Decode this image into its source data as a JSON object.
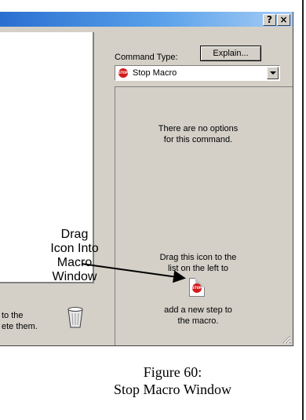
{
  "window": {
    "help_button": "?",
    "close_button": "×",
    "command_type_label": "Command Type:",
    "explain_button": "Explain...",
    "command_type_value": "Stop Macro",
    "no_options_line1": "There are no options",
    "no_options_line2": "for this command.",
    "drag_line1": "Drag this icon to the",
    "drag_line2": "list on the left to",
    "add_line1": "add a new step to",
    "add_line2": "the macro.",
    "trash_line1": "to the",
    "trash_line2": "ete them.",
    "stop_icon_text": "STOP"
  },
  "callout": {
    "line1": "Drag",
    "line2": "Icon Into",
    "line3": "Macro",
    "line4": "Window"
  },
  "caption": {
    "line1": "Figure 60:",
    "line2": "Stop Macro Window"
  },
  "colors": {
    "titlebar_start": "#2a6fd0",
    "titlebar_end": "#a8cdf5",
    "dialog_bg": "#d4d0c8",
    "stop_red": "#d21b1b"
  },
  "icons": [
    "help-icon",
    "close-icon",
    "stop-sign-icon",
    "dropdown-arrow-icon",
    "recycle-bin-icon",
    "resize-grip-icon"
  ]
}
